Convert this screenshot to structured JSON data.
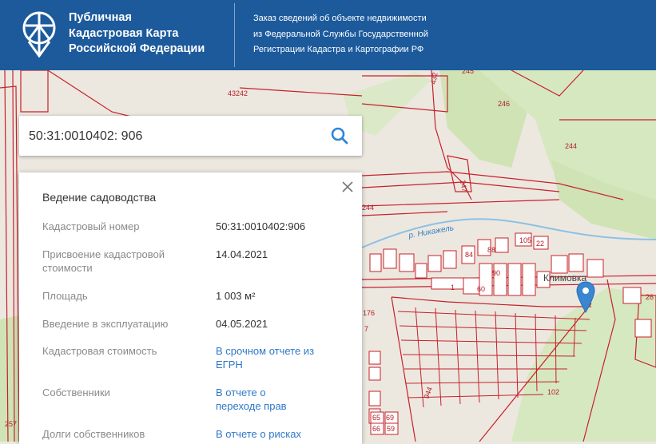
{
  "header": {
    "brand_line1": "Публичная",
    "brand_line2": "Кадастровая Карта",
    "brand_line3": "Российской Федерации",
    "order_line1": "Заказ сведений об объекте недвижимости",
    "order_line2": "из Федеральной Службы Государственной",
    "order_line3": "Регистрации Кадастра и Картографии РФ"
  },
  "search": {
    "value": "50:31:0010402: 906",
    "icon": "search-icon"
  },
  "panel": {
    "title": "Ведение садоводства",
    "rows": [
      {
        "label": "Кадастровый номер",
        "value": "50:31:0010402:906"
      },
      {
        "label": "Присвоение кадастровой стоимости",
        "value": "14.04.2021"
      },
      {
        "label": "Площадь",
        "value": "1 003 м²"
      },
      {
        "label": "Введение в эксплуатацию",
        "value": "04.05.2021"
      },
      {
        "label": "Кадастровая стоимость",
        "value": "В срочном отчете из ЕГРН"
      },
      {
        "label": "Собственники",
        "value": "В отчете о переходе прав"
      },
      {
        "label": "Долги собственников",
        "value": "В отчете о рисках"
      }
    ]
  },
  "map": {
    "labels": {
      "l43242": "43242",
      "l432": "432",
      "l245": "245",
      "l246": "246",
      "l244a": "244",
      "l244b": "244",
      "l247": "247",
      "river": "р. Никажель",
      "l105": "105",
      "l22": "22",
      "l84": "84",
      "l88": "88",
      "l90": "90",
      "l60": "60",
      "l1": "1",
      "l176": "176",
      "l7": "7",
      "l102": "102",
      "l944": "944",
      "l65": "65",
      "l69": "69",
      "l66": "66",
      "l59": "59",
      "l257": "257",
      "l26": "26",
      "village": "Климовка"
    },
    "colors": {
      "parcel": "#c8202a",
      "forest": "#cfe3b5",
      "land": "#ece8e0",
      "river": "#8fc0e4"
    }
  },
  "colors": {
    "header_bg": "#1c5a9c",
    "link": "#2f78c8",
    "pin": "#3a86d0"
  }
}
